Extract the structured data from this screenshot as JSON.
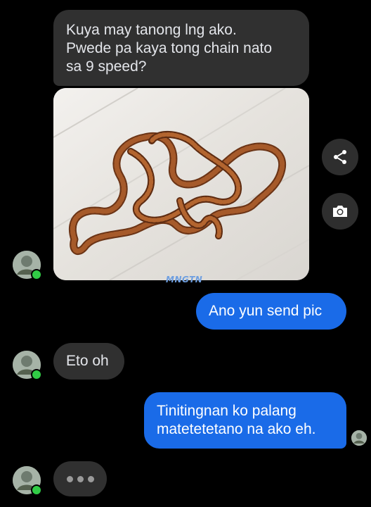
{
  "messages": {
    "m1": {
      "line1": "Kuya may tanong lng ako.",
      "line2": "Pwede pa kaya tong chain nato",
      "line3": "sa 9 speed?"
    },
    "photo": {
      "watermark": "MNGTN"
    },
    "m2": {
      "text": "Ano yun send pic"
    },
    "m3": {
      "text": "Eto oh"
    },
    "m4": {
      "line1": "Tinitingnan ko palang",
      "line2": "matetetetano na ako eh."
    }
  },
  "side_actions": {
    "share_icon": "share-icon",
    "camera_icon": "camera-icon"
  },
  "colors": {
    "background": "#000000",
    "incoming_bubble": "#303030",
    "outgoing_bubble": "#1a6be8",
    "online_dot": "#31cc46"
  }
}
